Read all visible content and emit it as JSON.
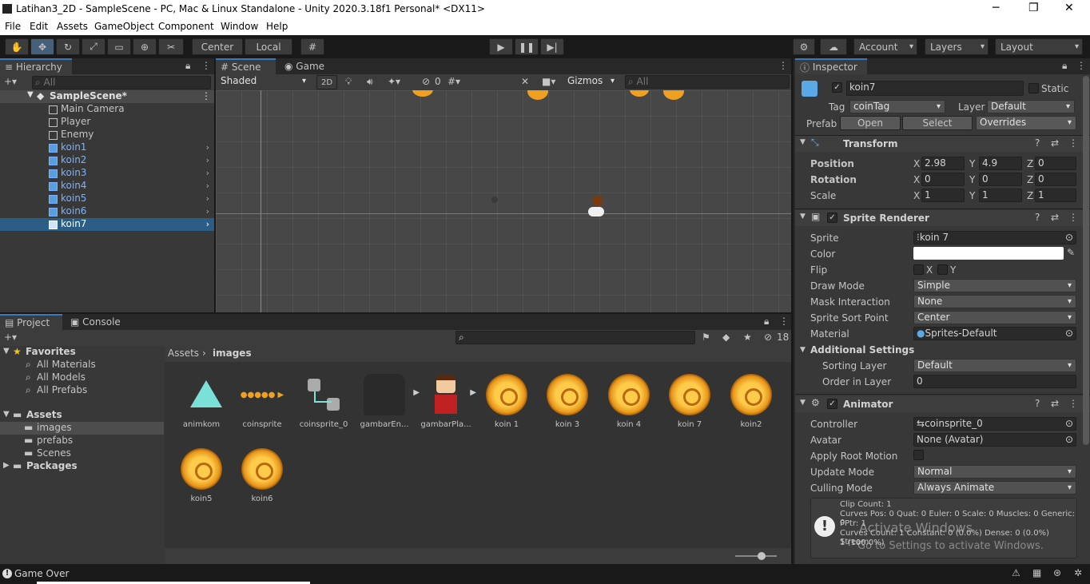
{
  "window": {
    "title": "Latihan3_2D - SampleScene - PC, Mac & Linux Standalone - Unity 2020.3.18f1 Personal* <DX11>",
    "minimize": "─",
    "maximize": "❐",
    "close": "✕"
  },
  "menu": [
    "File",
    "Edit",
    "Assets",
    "GameObject",
    "Component",
    "Window",
    "Help"
  ],
  "toolbar": {
    "center": "Center",
    "local": "Local",
    "account": "Account",
    "layers": "Layers",
    "layout": "Layout"
  },
  "hierarchy": {
    "tab": "Hierarchy",
    "search_placeholder": "All",
    "scene": "SampleScene*",
    "items": [
      "Main Camera",
      "Player",
      "Enemy",
      "koin1",
      "koin2",
      "koin3",
      "koin4",
      "koin5",
      "koin6",
      "koin7"
    ]
  },
  "scene": {
    "tab_scene": "Scene",
    "tab_game": "Game",
    "shade": "Shaded",
    "mode2d": "2D",
    "hidden_count": "0",
    "gizmos": "Gizmos",
    "search_placeholder": "All"
  },
  "project": {
    "tab_project": "Project",
    "tab_console": "Console",
    "favorites": "Favorites",
    "fav_items": [
      "All Materials",
      "All Models",
      "All Prefabs"
    ],
    "assets": "Assets",
    "asset_folders": [
      "images",
      "prefabs",
      "Scenes"
    ],
    "packages": "Packages",
    "breadcrumb_root": "Assets",
    "breadcrumb_current": "images",
    "count": "18",
    "assets_list": [
      "animkom",
      "coinsprite",
      "coinsprite_0",
      "gambarEn...",
      "gambarPla...",
      "koin 1",
      "koin 3",
      "koin 4",
      "koin 7",
      "koin2",
      "koin5",
      "koin6"
    ]
  },
  "inspector": {
    "tab": "Inspector",
    "object_name": "koin7",
    "static": "Static",
    "tag_label": "Tag",
    "tag": "coinTag",
    "layer_label": "Layer",
    "layer": "Default",
    "prefab_label": "Prefab",
    "open": "Open",
    "select": "Select",
    "overrides": "Overrides",
    "transform": {
      "title": "Transform",
      "position": "Position",
      "rotation": "Rotation",
      "scale": "Scale",
      "pos": [
        "2.98",
        "4.9",
        "0"
      ],
      "rot": [
        "0",
        "0",
        "0"
      ],
      "scl": [
        "1",
        "1",
        "1"
      ],
      "x": "X",
      "y": "Y",
      "z": "Z"
    },
    "sprite_renderer": {
      "title": "Sprite Renderer",
      "sprite_label": "Sprite",
      "sprite": "koin 7",
      "color_label": "Color",
      "flip_label": "Flip",
      "draw_mode_label": "Draw Mode",
      "draw_mode": "Simple",
      "mask_label": "Mask Interaction",
      "mask": "None",
      "sort_point_label": "Sprite Sort Point",
      "sort_point": "Center",
      "material_label": "Material",
      "material": "Sprites-Default",
      "additional": "Additional Settings",
      "sorting_layer_label": "Sorting Layer",
      "sorting_layer": "Default",
      "order_label": "Order in Layer",
      "order": "0"
    },
    "animator": {
      "title": "Animator",
      "controller_label": "Controller",
      "controller": "coinsprite_0",
      "avatar_label": "Avatar",
      "avatar": "None (Avatar)",
      "root_motion_label": "Apply Root Motion",
      "update_label": "Update Mode",
      "update": "Normal",
      "culling_label": "Culling Mode",
      "culling": "Always Animate",
      "info": [
        "Clip Count: 1",
        "Curves Pos: 0 Quat: 0 Euler: 0 Scale: 0 Muscles: 0 Generic: 0",
        "PPtr: 1",
        "Curves Count: 1 Constant: 0 (0.0%) Dense: 0 (0.0%) Stream:",
        "1 (100.0%)"
      ]
    },
    "watermark1": "Activate Windows",
    "watermark2": "Go to Settings to activate Windows."
  },
  "status": {
    "message": "Game Over"
  },
  "colors": {
    "accent": "#3a79bb",
    "selection": "#2c5d87",
    "prefab_blue": "#7bb2ff"
  }
}
